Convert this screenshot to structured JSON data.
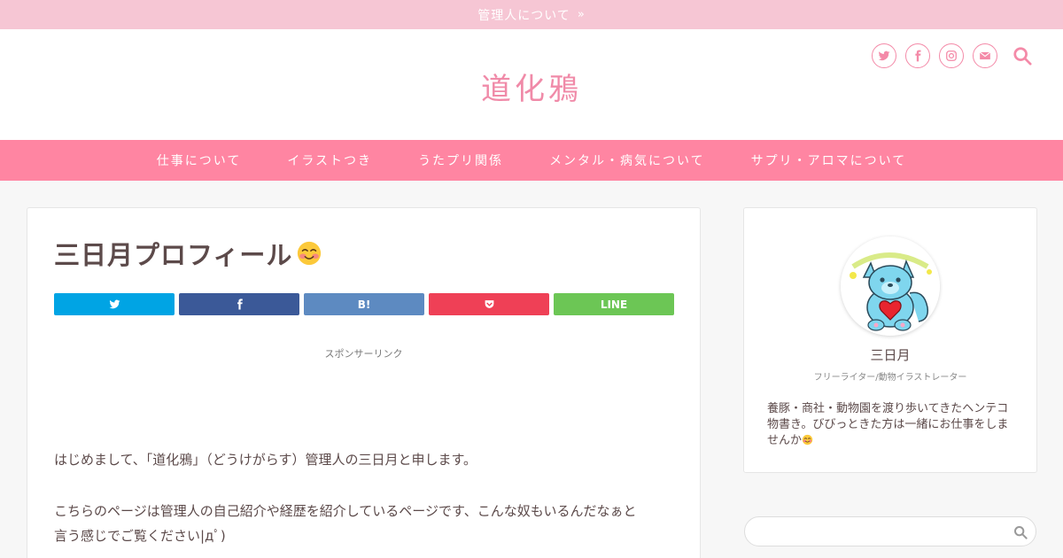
{
  "topbar": {
    "link_label": "管理人について",
    "chevron": "»"
  },
  "header": {
    "site_title": "道化鴉",
    "social_icons": [
      "twitter-icon",
      "facebook-icon",
      "instagram-icon",
      "mail-icon"
    ],
    "search_icon": "search-icon"
  },
  "nav": {
    "items": [
      {
        "label": "仕事について"
      },
      {
        "label": "イラストつき"
      },
      {
        "label": "うたプリ関係"
      },
      {
        "label": "メンタル・病気について"
      },
      {
        "label": "サプリ・アロマについて"
      }
    ]
  },
  "post": {
    "title": "三日月プロフィール",
    "title_emoji": "smiling-face-emoji",
    "share_buttons": [
      {
        "name": "twitter",
        "label": "",
        "color": "#00a4e4",
        "icon": "twitter-icon"
      },
      {
        "name": "facebook",
        "label": "",
        "color": "#3b5998",
        "icon": "facebook-icon"
      },
      {
        "name": "hatena",
        "label": "B!",
        "color": "#5d8ac1",
        "icon": ""
      },
      {
        "name": "pocket",
        "label": "",
        "color": "#ef4056",
        "icon": "pocket-icon"
      },
      {
        "name": "line",
        "label": "LINE",
        "color": "#6cc655",
        "icon": ""
      }
    ],
    "sponsor_label": "スポンサーリンク",
    "paragraph1": "はじめまして、「道化鴉」（どうけがらす）管理人の三日月と申します。",
    "paragraph2_line1": "こちらのページは管理人の自己紹介や経歴を紹介しているページです、こんな奴もいるんだなぁと",
    "paragraph2_line2": "言う感じでご覧ください|дﾟ)"
  },
  "sidebar": {
    "profile": {
      "name": "三日月",
      "role": "フリーライター/動物イラストレーター",
      "bio": "養豚・商社・動物園を渡り歩いてきたヘンテコ物書き。びびっときた方は一緒にお仕事をしませんか",
      "bio_emoji": "smiling-face-emoji"
    },
    "search": {
      "placeholder": "",
      "icon": "search-icon"
    }
  },
  "colors": {
    "topbar": "#f6c6d4",
    "accent": "#f48aa8",
    "nav": "#ff85a2",
    "text": "#5c4a4a"
  }
}
